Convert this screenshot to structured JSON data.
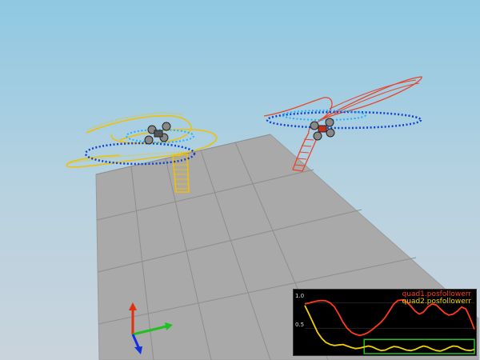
{
  "colors": {
    "sky_top": "#8fc8e2",
    "ground": "#a9a9a9",
    "ground_grid": "#8e8e8e",
    "quad1_trail": "#e8452a",
    "quad2_trail": "#f0c000",
    "waypoint_path": "#1040d0",
    "waypoint_path_light": "#20b0ff",
    "plot_bg": "#000000"
  },
  "scene": {
    "quadcopters": [
      {
        "name": "quad1",
        "color": "red"
      },
      {
        "name": "quad2",
        "color": "yellow"
      }
    ],
    "axes_gizmo": {
      "x_color": "#20c020",
      "y_color": "#1030e0",
      "z_color": "#e03010"
    }
  },
  "plot": {
    "legend": [
      {
        "label": "quad1.posfollowerr",
        "color": "#ff3a1a"
      },
      {
        "label": "quad2.posfollowerr",
        "color": "#f0d000"
      }
    ],
    "yticks": [
      "1.0",
      "0.5"
    ],
    "icons": [
      "chart-icon"
    ],
    "chart_data": {
      "type": "line",
      "ylim": [
        0,
        1.2
      ],
      "x": [
        0,
        1,
        2,
        3,
        4,
        5,
        6,
        7,
        8,
        9,
        10,
        11,
        12,
        13,
        14,
        15,
        16,
        17,
        18,
        19,
        20,
        21,
        22,
        23,
        24,
        25,
        26,
        27,
        28,
        29,
        30,
        31,
        32,
        33,
        34,
        35,
        36,
        37,
        38,
        39,
        40
      ],
      "series": [
        {
          "name": "quad1.posfollowerr",
          "color": "#ff3a1a",
          "values": [
            0.98,
            1.0,
            1.02,
            1.04,
            1.05,
            1.04,
            1.0,
            0.92,
            0.78,
            0.62,
            0.5,
            0.42,
            0.38,
            0.36,
            0.38,
            0.42,
            0.48,
            0.55,
            0.62,
            0.72,
            0.85,
            0.98,
            1.05,
            1.06,
            1.02,
            0.94,
            0.84,
            0.78,
            0.82,
            0.92,
            0.98,
            0.96,
            0.88,
            0.8,
            0.76,
            0.78,
            0.84,
            0.92,
            0.88,
            0.7,
            0.48
          ]
        },
        {
          "name": "quad2.posfollowerr",
          "color": "#f0d000",
          "values": [
            0.95,
            0.78,
            0.6,
            0.42,
            0.3,
            0.22,
            0.18,
            0.16,
            0.17,
            0.18,
            0.15,
            0.12,
            0.1,
            0.11,
            0.13,
            0.15,
            0.13,
            0.09,
            0.06,
            0.07,
            0.11,
            0.14,
            0.13,
            0.1,
            0.07,
            0.06,
            0.08,
            0.12,
            0.15,
            0.13,
            0.09,
            0.06,
            0.05,
            0.08,
            0.12,
            0.15,
            0.14,
            0.1,
            0.07,
            0.06,
            0.08
          ]
        }
      ],
      "highlight_box": {
        "x_start": 14,
        "x_end": 40,
        "y_start": 0,
        "y_end": 0.28
      }
    }
  }
}
